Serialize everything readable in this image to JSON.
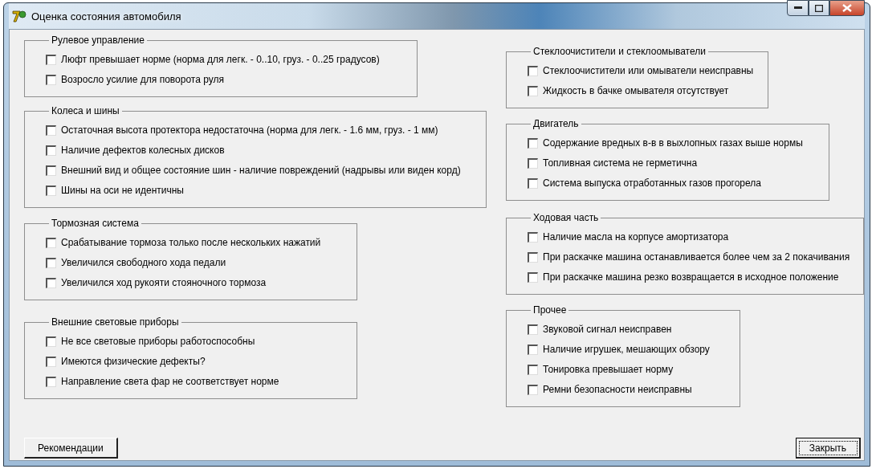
{
  "window": {
    "title": "Оценка состояния автомобиля"
  },
  "columns": [
    [
      {
        "title": "Рулевое управление",
        "items": [
          {
            "label": "Люфт превышает норме (норма для легк. - 0..10, груз. - 0..25 градусов)",
            "checked": false
          },
          {
            "label": "Возросло усилие для поворота руля",
            "checked": false
          }
        ]
      },
      {
        "title": "Колеса и шины",
        "items": [
          {
            "label": "Остаточная высота протектора недостаточна (норма для легк. - 1.6 мм, груз. - 1 мм)",
            "checked": false
          },
          {
            "label": "Наличие дефектов колесных дисков",
            "checked": false
          },
          {
            "label": "Внешний вид и общее состояние шин - наличие повреждений (надрывы или виден корд)",
            "checked": false
          },
          {
            "label": "Шины на оси не идентичны",
            "checked": false
          }
        ]
      },
      {
        "title": "Тормозная система",
        "items": [
          {
            "label": "Срабатывание тормоза только после нескольких нажатий",
            "checked": false
          },
          {
            "label": "Увеличился свободного хода педали",
            "checked": false
          },
          {
            "label": "Увеличился ход рукояти стояночного тормоза",
            "checked": false
          }
        ]
      },
      {
        "title": "Внешние световые приборы",
        "items": [
          {
            "label": "Не все световые приборы работоспособны",
            "checked": false
          },
          {
            "label": "Имеются физические дефекты?",
            "checked": false
          },
          {
            "label": "Направление света фар не соответствует норме",
            "checked": false
          }
        ]
      }
    ],
    [
      {
        "title": "Стеклоочистители и стеклоомыватели",
        "items": [
          {
            "label": "Стеклоочистители или омыватели неисправны",
            "checked": false
          },
          {
            "label": "Жидкость в бачке омывателя отсутствует",
            "checked": false
          }
        ]
      },
      {
        "title": "Двигатель",
        "items": [
          {
            "label": "Содержание вредных в-в в выхлопных газах выше нормы",
            "checked": false
          },
          {
            "label": "Топливная система не герметична",
            "checked": false
          },
          {
            "label": "Система выпуска отработанных газов прогорела",
            "checked": false
          }
        ]
      },
      {
        "title": "Ходовая часть",
        "items": [
          {
            "label": "Наличие масла на корпусе амортизатора",
            "checked": false
          },
          {
            "label": "При раскачке машина останавливается более чем за 2 покачивания",
            "checked": false
          },
          {
            "label": "При раскачке машина резко возвращается в исходное положение",
            "checked": false
          }
        ]
      },
      {
        "title": "Прочее",
        "items": [
          {
            "label": "Звуковой сигнал неисправен",
            "checked": false
          },
          {
            "label": "Наличие игрушек, мешающих обзору",
            "checked": false
          },
          {
            "label": "Тонировка превышает норму",
            "checked": false
          },
          {
            "label": "Ремни безопасности неисправны",
            "checked": false
          }
        ]
      }
    ]
  ],
  "buttons": [
    {
      "label": "Рекомендации",
      "focused": false
    },
    {
      "label": "Закрыть",
      "focused": true
    }
  ]
}
